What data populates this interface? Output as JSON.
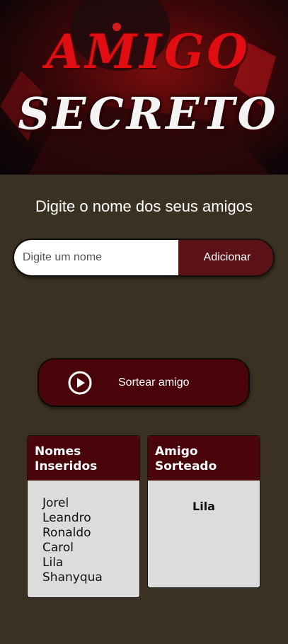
{
  "hero": {
    "title_line1": "AMIGO",
    "title_line2": "SECRETO",
    "accent_color": "#e00d12"
  },
  "subtitle": "Digite o nome dos seus amigos",
  "input": {
    "placeholder": "Digite um nome",
    "value": ""
  },
  "add_button_label": "Adicionar",
  "draw_button": {
    "label": "Sortear amigo",
    "icon": "play-circle-icon"
  },
  "names_card": {
    "title": "Nomes Inseridos",
    "names": [
      "Jorel",
      "Leandro",
      "Ronaldo",
      "Carol",
      "Lila",
      "Shanyqua"
    ]
  },
  "drawn_card": {
    "title": "Amigo Sorteado",
    "result": "Lila"
  },
  "colors": {
    "background": "#3b3122",
    "primary": "#4a050a",
    "button_secondary": "#5a1216",
    "card_body": "#dcdcdc"
  }
}
